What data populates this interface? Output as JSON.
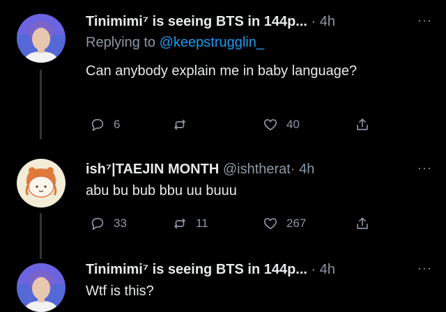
{
  "tweets": [
    {
      "display_name": "Tinimimi⁷ is seeing BTS in 144p...",
      "handle": "",
      "separator": "·",
      "time": "4h",
      "more": "···",
      "replying_prefix": "Replying to ",
      "replying_to": "@keepstrugglin_",
      "text": "Can anybody explain me in baby language?",
      "replies": "6",
      "retweets": "",
      "likes": "40"
    },
    {
      "display_name": "ish⁷|TAEJIN MONTH",
      "handle": "@ishtherat",
      "separator": "·",
      "time": "4h",
      "more": "···",
      "text": "abu bu bub bbu uu buuu",
      "replies": "33",
      "retweets": "11",
      "likes": "267"
    },
    {
      "display_name": "Tinimimi⁷ is seeing BTS in 144p...",
      "handle": "",
      "separator": "·",
      "time": "4h",
      "more": "···",
      "text": "Wtf is this?"
    }
  ],
  "icons": {
    "reply": "reply-icon",
    "retweet": "retweet-icon",
    "like": "heart-icon",
    "share": "share-icon",
    "more": "more-icon"
  },
  "colors": {
    "background": "#000000",
    "text": "#e7e9ea",
    "secondary": "#8b98a5",
    "link": "#1d9bf0",
    "thread_line": "#2f3336"
  }
}
